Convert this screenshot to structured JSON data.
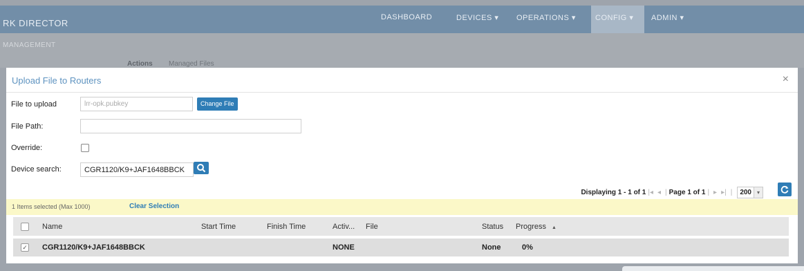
{
  "app": {
    "brand": "RK DIRECTOR",
    "nav": [
      "DASHBOARD",
      "DEVICES ▾",
      "OPERATIONS ▾",
      "CONFIG ▾",
      "ADMIN ▾"
    ],
    "section": "MANAGEMENT",
    "tabs": [
      "Actions",
      "Managed Files"
    ]
  },
  "modal": {
    "title": "Upload File to Routers",
    "close": "×",
    "fields": {
      "file_label": "File to upload",
      "file_placeholder": "lrr-opk.pubkey",
      "change_file": "Change File",
      "path_label": "File Path:",
      "override_label": "Override:",
      "search_label": "Device search:",
      "search_value": "CGR1120/K9+JAF1648BBCK"
    },
    "pager": {
      "displaying": "Displaying 1 - 1 of 1",
      "page": "Page",
      "page_num": "1",
      "of": "of 1",
      "page_size": "200"
    },
    "selection": {
      "count": "1 Items selected (Max 1000)",
      "clear": "Clear Selection"
    },
    "table": {
      "columns": [
        "Name",
        "Start Time",
        "Finish Time",
        "Activ...",
        "File",
        "Status",
        "Progress"
      ],
      "rows": [
        {
          "name": "CGR1120/K9+JAF1648BBCK",
          "start": "",
          "finish": "",
          "activity": "NONE",
          "file": "",
          "status": "None",
          "progress": "0%",
          "checked": "✓"
        }
      ]
    }
  },
  "colors": {
    "accent": "#2f7db6",
    "title": "#5e93c0",
    "selection_bar": "#fbf8c8",
    "overlay": "#9ea4ac"
  },
  "icons": {
    "search": "search-icon",
    "refresh": "refresh-icon",
    "close": "close-icon",
    "sort": "sort-asc-icon"
  }
}
